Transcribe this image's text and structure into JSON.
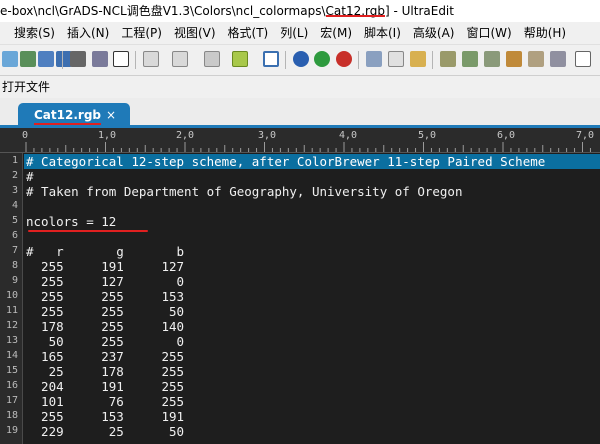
{
  "titlebar": {
    "path_prefix": "e-box\\ncl\\GrADS-NCL调色盘V1.3\\Colors\\ncl_colormaps\\",
    "file": "Cat12.rgb",
    "suffix": "] - UltraEdit"
  },
  "menu": [
    "搜索(S)",
    "插入(N)",
    "工程(P)",
    "视图(V)",
    "格式(T)",
    "列(L)",
    "宏(M)",
    "脚本(I)",
    "高级(A)",
    "窗口(W)",
    "帮助(H)"
  ],
  "open_files_label": "打开文件",
  "tab": {
    "label": "Cat12.rgb",
    "close": "×"
  },
  "ruler": [
    "0",
    "1,0",
    "2,0",
    "3,0",
    "4,0",
    "5,0",
    "6,0",
    "7,0"
  ],
  "lines": [
    "# Categorical 12-step scheme, after ColorBrewer 11-step Paired Scheme",
    "#",
    "# Taken from Department of Geography, University of Oregon",
    "",
    "ncolors = 12",
    "",
    "#   r       g       b",
    "  255     191     127",
    "  255     127       0",
    "  255     255     153",
    "  255     255      50",
    "  178     255     140",
    "   50     255       0",
    "  165     237     255",
    "   25     178     255",
    "  204     191     255",
    "  101      76     255",
    "  255     153     191",
    "  229      25      50"
  ],
  "line_numbers": [
    "1",
    "2",
    "3",
    "4",
    "5",
    "6",
    "7",
    "8",
    "9",
    "10",
    "11",
    "12",
    "13",
    "14",
    "15",
    "16",
    "17",
    "18",
    "19"
  ],
  "colors": {
    "tab": "#1f7ab8",
    "selection": "#0b6fa0",
    "annotation": "#e02020",
    "editor_bg": "#1e1e1e"
  }
}
